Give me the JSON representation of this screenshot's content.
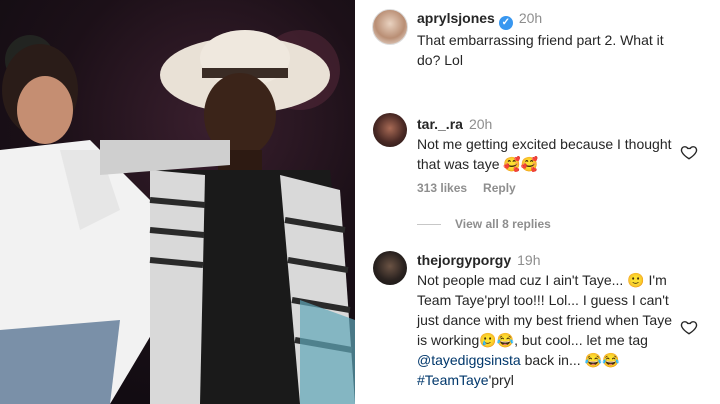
{
  "photo": {
    "alt": ""
  },
  "comments": [
    {
      "username": "aprylsjones",
      "verified": true,
      "time": "20h",
      "text": "That embarrassing friend part 2. What it do? Lol"
    },
    {
      "username": "tar._.ra",
      "time": "20h",
      "text": "Not me getting excited because I thought that was taye 🥰🥰",
      "likes": "313 likes",
      "reply": "Reply",
      "view_replies": "View all 8 replies"
    },
    {
      "username": "thejorgyporgy",
      "time": "19h",
      "text_part1": "Not people mad cuz I ain't Taye... 🙂 I'm Team Taye'pryl too!!! Lol... I guess I can't just dance with my best friend when Taye is working🥲😂, but cool... let me tag ",
      "mention1": "@tayediggsinsta",
      "text_part2": " back in... 😂😂 ",
      "mention2": "#TeamTaye",
      "text_part3": "'pryl"
    }
  ],
  "icons": {
    "verified": "verified-badge-icon",
    "heart": "heart-outline-icon"
  }
}
